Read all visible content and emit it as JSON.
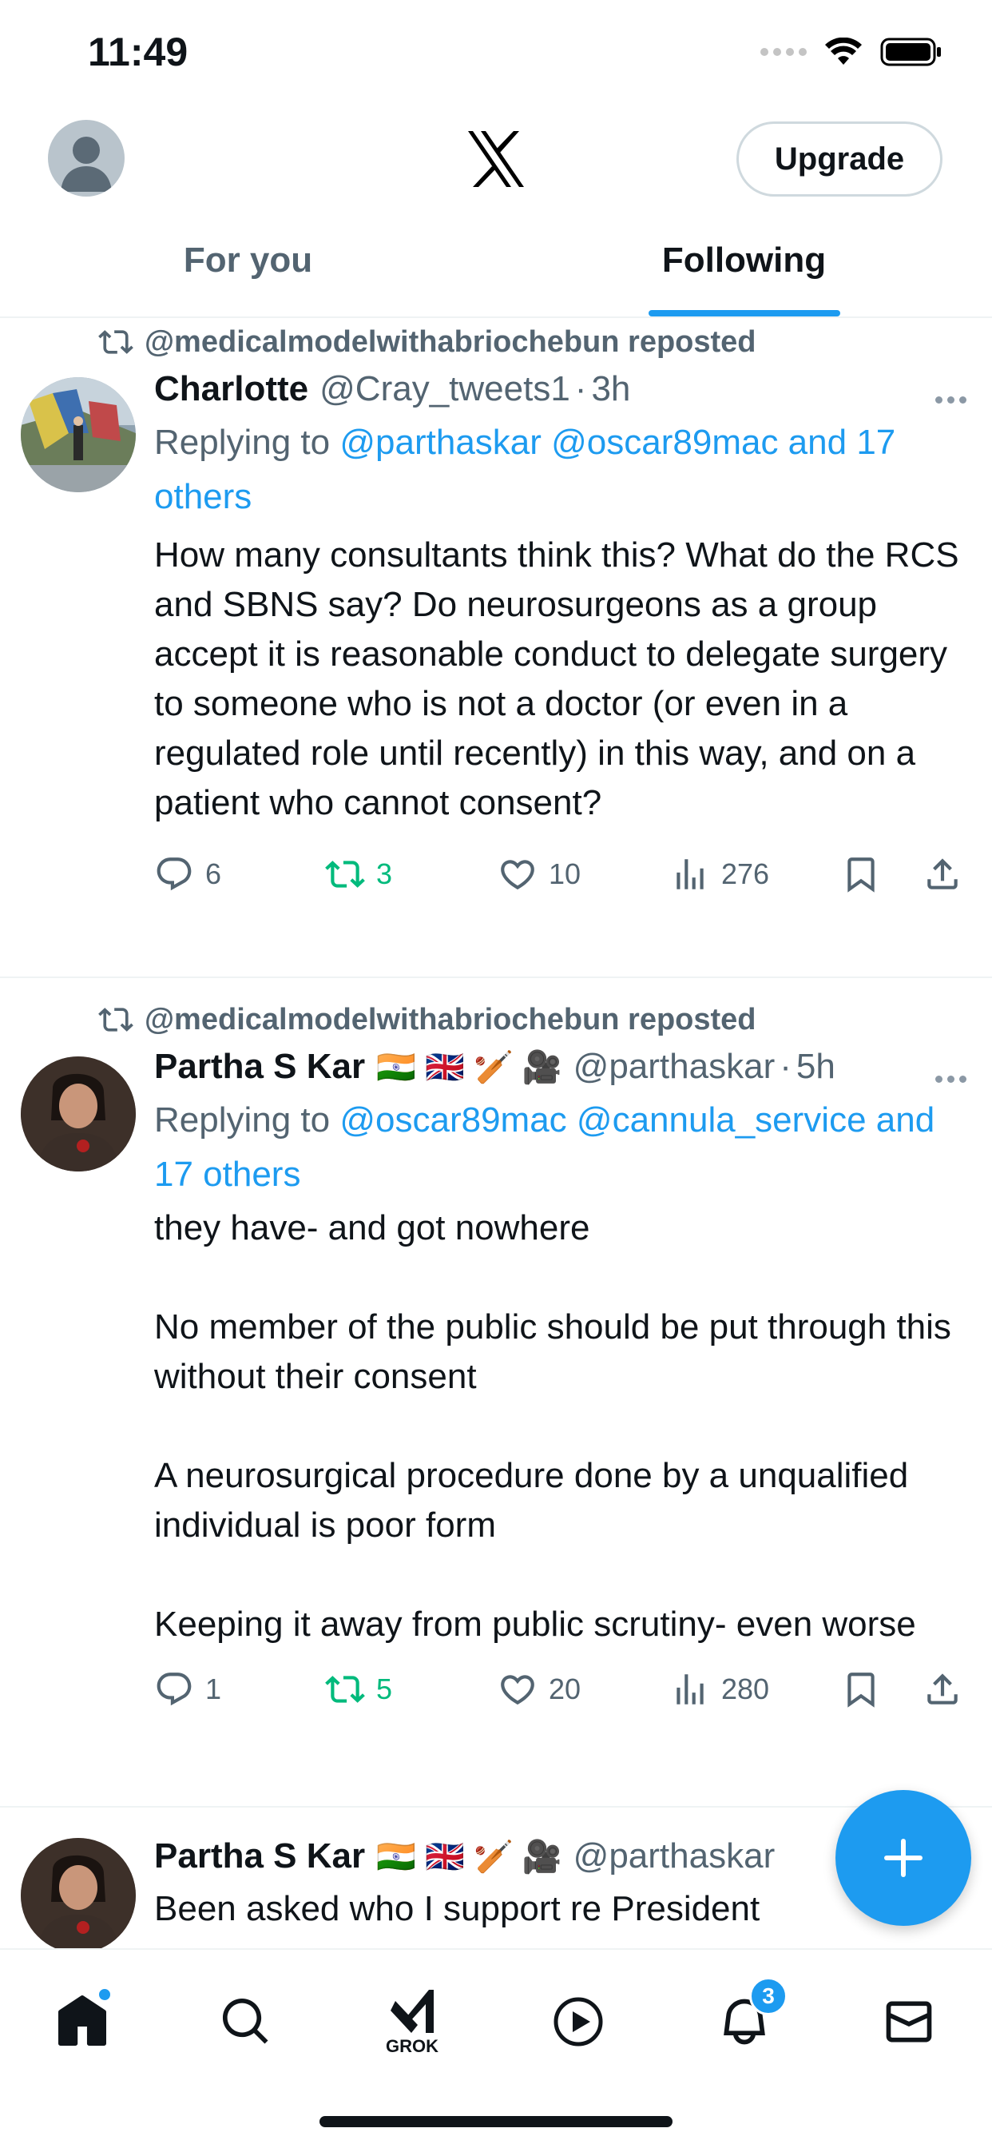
{
  "status_bar": {
    "time": "11:49"
  },
  "header": {
    "upgrade_label": "Upgrade"
  },
  "tabs": [
    {
      "label": "For you",
      "active": false
    },
    {
      "label": "Following",
      "active": true
    }
  ],
  "tweets": [
    {
      "repost_text": "@medicalmodelwithabriochebun reposted",
      "name": "Charlotte",
      "handle": "@Cray_tweets1",
      "time": "3h",
      "reply_prefix": "Replying to ",
      "reply_links": "@parthaskar @oscar89mac and 17 others",
      "text": "How many consultants think this? What do the RCS and SBNS say? Do neurosurgeons as a group accept it is reasonable conduct to delegate surgery to someone who is not a doctor (or even in a regulated role until recently) in this way, and on a patient who cannot consent?",
      "replies": "6",
      "reposts": "3",
      "likes": "10",
      "views": "276"
    },
    {
      "repost_text": "@medicalmodelwithabriochebun reposted",
      "name": "Partha S Kar",
      "flags": "🇮🇳 🇬🇧 🏏 🎥",
      "handle": "@parthaskar",
      "time": "5h",
      "reply_prefix": "Replying to ",
      "reply_links": "@oscar89mac @cannula_service and 17 others",
      "text": "they have- and got nowhere\n\nNo member of the public should be put through this without their consent\n\nA neurosurgical procedure done by a unqualified individual is poor form\n\nKeeping it away from public scrutiny- even worse",
      "replies": "1",
      "reposts": "5",
      "likes": "20",
      "views": "280"
    },
    {
      "name": "Partha S Kar",
      "flags": "🇮🇳 🇬🇧 🏏 🎥",
      "handle": "@parthaskar",
      "text": "Been asked who I support re President"
    }
  ],
  "bottom_nav": {
    "grok_label": "GROK",
    "notifications_badge": "3"
  },
  "colors": {
    "accent": "#1d9bf0",
    "repost_green": "#00ba7c",
    "secondary_text": "#536471"
  }
}
